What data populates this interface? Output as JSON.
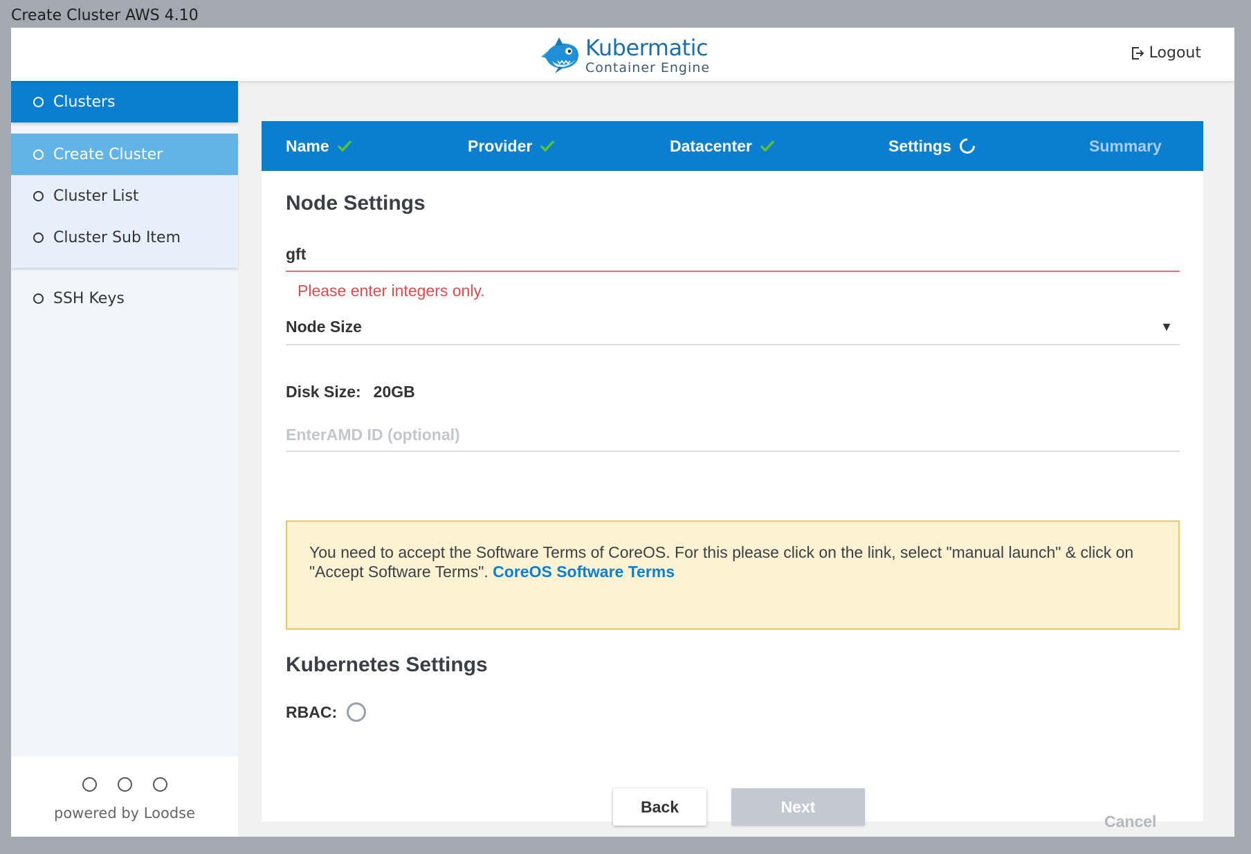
{
  "window": {
    "title": "Create Cluster AWS 4.10"
  },
  "header": {
    "logo": {
      "name": "Kubermatic",
      "subtitle": "Container Engine"
    },
    "logout_label": "Logout"
  },
  "sidebar": {
    "items": [
      {
        "label": "Clusters"
      },
      {
        "label": "Create Cluster"
      },
      {
        "label": "Cluster List"
      },
      {
        "label": "Cluster Sub Item"
      },
      {
        "label": "SSH Keys"
      }
    ],
    "footer": {
      "powered_by": "powered by Loodse"
    }
  },
  "wizard": {
    "steps": [
      {
        "label": "Name",
        "state": "done"
      },
      {
        "label": "Provider",
        "state": "done"
      },
      {
        "label": "Datacenter",
        "state": "done"
      },
      {
        "label": "Settings",
        "state": "active"
      },
      {
        "label": "Summary",
        "state": "pending"
      }
    ],
    "node_settings": {
      "title": "Node Settings",
      "node_count_value": "gft",
      "node_count_error": "Please enter integers only.",
      "node_size_label": "Node Size",
      "disk_size_label": "Disk Size:",
      "disk_size_value": "20GB",
      "ami_placeholder": "EnterAMD ID (optional)"
    },
    "notice": {
      "text": "You need to accept the Software Terms of CoreOS. For this please click on the link, select \"manual launch\" & click on \"Accept Software Terms\".",
      "link_label": "CoreOS Software Terms"
    },
    "kubernetes_settings": {
      "title": "Kubernetes Settings",
      "rbac_label": "RBAC:"
    },
    "buttons": {
      "back": "Back",
      "next": "Next",
      "cancel": "Cancel"
    }
  },
  "colors": {
    "primary": "#0a7fd0",
    "sidebar_active": "#63b4e6",
    "check": "#5cc32e",
    "error": "#e04a51",
    "notice_bg": "#fdf3d2",
    "notice_border": "#f2c464"
  }
}
